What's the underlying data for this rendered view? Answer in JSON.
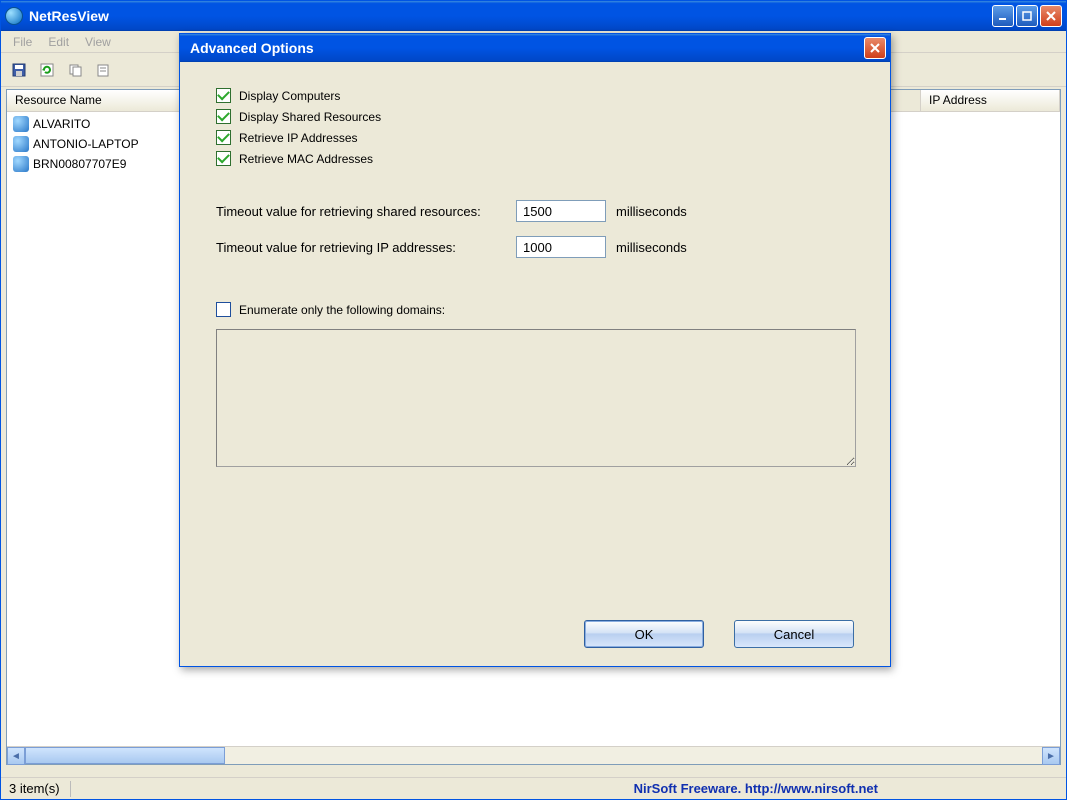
{
  "mainWindow": {
    "title": "NetResView",
    "menu": {
      "file": "File",
      "edit": "Edit",
      "view": "View"
    },
    "columns": {
      "resourceName": "Resource Name",
      "ipAddress": "IP Address"
    },
    "rows": [
      {
        "name": "ALVARITO"
      },
      {
        "name": "ANTONIO-LAPTOP"
      },
      {
        "name": "BRN00807707E9"
      }
    ],
    "status": {
      "count": "3 item(s)",
      "credit": "NirSoft Freeware.  http://www.nirsoft.net"
    }
  },
  "dialog": {
    "title": "Advanced Options",
    "checks": {
      "displayComputers": "Display Computers",
      "displayShared": "Display Shared Resources",
      "retrieveIP": "Retrieve IP Addresses",
      "retrieveMAC": "Retrieve MAC Addresses",
      "enumDomains": "Enumerate only the following domains:"
    },
    "timeoutShared": {
      "label": "Timeout value for retrieving shared resources:",
      "value": "1500",
      "unit": "milliseconds"
    },
    "timeoutIP": {
      "label": "Timeout value for retrieving IP addresses:",
      "value": "1000",
      "unit": "milliseconds"
    },
    "buttons": {
      "ok": "OK",
      "cancel": "Cancel"
    }
  }
}
